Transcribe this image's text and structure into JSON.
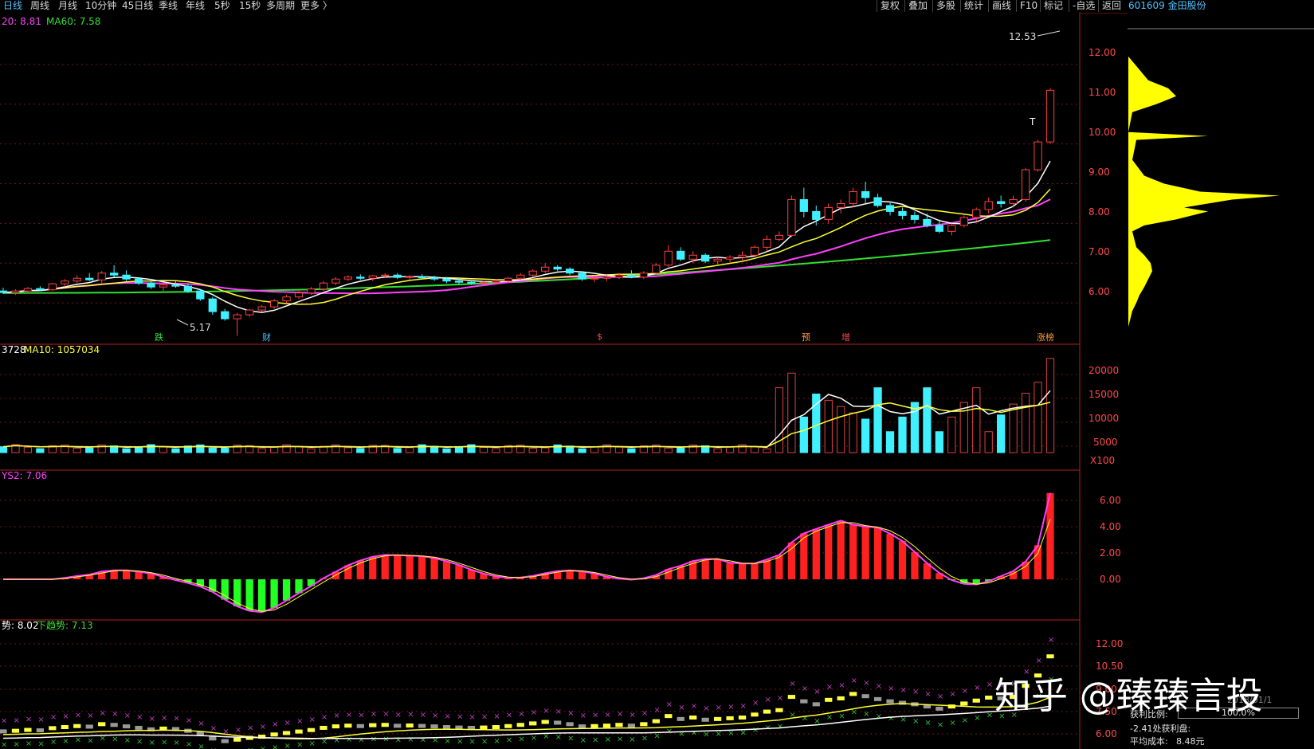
{
  "toolbar": {
    "tabs": [
      "日线",
      "周线",
      "月线",
      "10分钟",
      "45日线",
      "季线",
      "年线",
      "5秒",
      "15秒",
      "多周期",
      "更多 〉"
    ],
    "active_tab": 0,
    "right_buttons": [
      "复权",
      "叠加",
      "多股",
      "统计",
      "画线",
      "F10",
      "标记",
      "-自选",
      "返回"
    ],
    "stock": "601609 金田股份"
  },
  "main_panel": {
    "ma_header": [
      {
        "label": "20: 8.81",
        "color": "#ff40ff"
      },
      {
        "label": "MA60: 7.58",
        "color": "#33e033"
      }
    ],
    "price_ticks": [
      "12.00",
      "11.00",
      "10.00",
      "9.00",
      "8.00",
      "7.00",
      "6.00"
    ],
    "high_label": "12.53",
    "low_label": "5.17",
    "t_marker": "T",
    "events": [
      {
        "text": "跌",
        "color": "#33e033"
      },
      {
        "text": "财",
        "color": "#4fc3ff"
      },
      {
        "text": "$",
        "color": "#ff4a4a"
      },
      {
        "text": "预",
        "color": "#ff9a3c"
      },
      {
        "text": "增",
        "color": "#ff4a4a"
      },
      {
        "text": "涨榜",
        "color": "#ff9a3c"
      }
    ]
  },
  "volume_panel": {
    "header": [
      {
        "label": "3728",
        "color": "#ffffff"
      },
      {
        "label": "MA10: 1057034",
        "color": "#ffff33"
      }
    ],
    "ticks": [
      "20000",
      "15000",
      "10000",
      "5000"
    ],
    "unit": "X100"
  },
  "macd_panel": {
    "header": [
      {
        "label": "YS2: 7.06",
        "color": "#ff40ff"
      }
    ],
    "ticks": [
      "6.00",
      "4.00",
      "2.00",
      "0.00"
    ]
  },
  "trend_panel": {
    "header": [
      {
        "label": "势: 8.02",
        "color": "#ffffff"
      },
      {
        "label": "下趋势: 7.13",
        "color": "#33e033"
      }
    ],
    "ticks": [
      "12.00",
      "10.50",
      "9.00",
      "7.50",
      "6.00"
    ]
  },
  "chip_panel": {
    "date_text": "2018/01/1",
    "profit_label": "获利比例:",
    "profit_value": "100.0%",
    "profit_curve": "-2.41处获利盘:",
    "avg_cost_label": "平均成本:",
    "avg_cost_value": "8.48元"
  },
  "watermark": "知乎 @臻臻言投",
  "chart_data": {
    "type": "candlestick",
    "price_range": [
      5.0,
      12.9
    ],
    "candles": [
      [
        6.3,
        6.38,
        6.22,
        6.26
      ],
      [
        6.26,
        6.34,
        6.2,
        6.3
      ],
      [
        6.3,
        6.4,
        6.25,
        6.36
      ],
      [
        6.36,
        6.42,
        6.3,
        6.33
      ],
      [
        6.33,
        6.5,
        6.3,
        6.48
      ],
      [
        6.48,
        6.6,
        6.4,
        6.55
      ],
      [
        6.55,
        6.7,
        6.5,
        6.62
      ],
      [
        6.62,
        6.75,
        6.55,
        6.58
      ],
      [
        6.58,
        6.8,
        6.5,
        6.75
      ],
      [
        6.75,
        6.95,
        6.65,
        6.7
      ],
      [
        6.7,
        6.82,
        6.55,
        6.6
      ],
      [
        6.6,
        6.65,
        6.45,
        6.5
      ],
      [
        6.5,
        6.55,
        6.35,
        6.4
      ],
      [
        6.4,
        6.5,
        6.3,
        6.45
      ],
      [
        6.45,
        6.55,
        6.38,
        6.42
      ],
      [
        6.42,
        6.48,
        6.25,
        6.3
      ],
      [
        6.3,
        6.35,
        6.05,
        6.1
      ],
      [
        6.1,
        6.15,
        5.7,
        5.78
      ],
      [
        5.78,
        5.85,
        5.55,
        5.6
      ],
      [
        5.6,
        5.75,
        5.17,
        5.7
      ],
      [
        5.7,
        5.85,
        5.65,
        5.82
      ],
      [
        5.82,
        5.95,
        5.78,
        5.9
      ],
      [
        5.9,
        6.1,
        5.85,
        6.05
      ],
      [
        6.05,
        6.2,
        6.0,
        6.15
      ],
      [
        6.15,
        6.3,
        6.1,
        6.25
      ],
      [
        6.25,
        6.4,
        6.2,
        6.35
      ],
      [
        6.35,
        6.55,
        6.3,
        6.5
      ],
      [
        6.5,
        6.65,
        6.45,
        6.6
      ],
      [
        6.6,
        6.7,
        6.55,
        6.65
      ],
      [
        6.65,
        6.72,
        6.58,
        6.62
      ],
      [
        6.62,
        6.7,
        6.55,
        6.68
      ],
      [
        6.68,
        6.75,
        6.62,
        6.7
      ],
      [
        6.7,
        6.75,
        6.6,
        6.64
      ],
      [
        6.64,
        6.7,
        6.58,
        6.66
      ],
      [
        6.66,
        6.72,
        6.6,
        6.63
      ],
      [
        6.63,
        6.68,
        6.55,
        6.6
      ],
      [
        6.6,
        6.65,
        6.5,
        6.55
      ],
      [
        6.55,
        6.62,
        6.48,
        6.52
      ],
      [
        6.52,
        6.58,
        6.45,
        6.5
      ],
      [
        6.5,
        6.55,
        6.45,
        6.52
      ],
      [
        6.52,
        6.6,
        6.48,
        6.55
      ],
      [
        6.55,
        6.65,
        6.5,
        6.62
      ],
      [
        6.62,
        6.75,
        6.58,
        6.7
      ],
      [
        6.7,
        6.85,
        6.65,
        6.8
      ],
      [
        6.8,
        7.0,
        6.75,
        6.9
      ],
      [
        6.9,
        6.95,
        6.8,
        6.85
      ],
      [
        6.85,
        6.9,
        6.7,
        6.75
      ],
      [
        6.75,
        6.8,
        6.55,
        6.6
      ],
      [
        6.6,
        6.68,
        6.52,
        6.62
      ],
      [
        6.62,
        6.7,
        6.55,
        6.65
      ],
      [
        6.65,
        6.75,
        6.6,
        6.7
      ],
      [
        6.7,
        6.82,
        6.62,
        6.65
      ],
      [
        6.65,
        6.8,
        6.6,
        6.75
      ],
      [
        6.75,
        7.0,
        6.7,
        6.95
      ],
      [
        6.95,
        7.45,
        6.9,
        7.3
      ],
      [
        7.3,
        7.4,
        7.05,
        7.1
      ],
      [
        7.1,
        7.3,
        7.0,
        7.2
      ],
      [
        7.2,
        7.25,
        7.0,
        7.05
      ],
      [
        7.05,
        7.15,
        6.95,
        7.1
      ],
      [
        7.1,
        7.2,
        7.0,
        7.15
      ],
      [
        7.15,
        7.3,
        7.05,
        7.2
      ],
      [
        7.2,
        7.45,
        7.15,
        7.4
      ],
      [
        7.4,
        7.7,
        7.3,
        7.6
      ],
      [
        7.6,
        7.8,
        7.55,
        7.7
      ],
      [
        7.7,
        8.7,
        7.65,
        8.6
      ],
      [
        8.6,
        8.9,
        8.15,
        8.3
      ],
      [
        8.3,
        8.45,
        7.95,
        8.1
      ],
      [
        8.1,
        8.5,
        8.0,
        8.4
      ],
      [
        8.4,
        8.6,
        8.25,
        8.5
      ],
      [
        8.5,
        8.9,
        8.4,
        8.8
      ],
      [
        8.8,
        9.05,
        8.5,
        8.65
      ],
      [
        8.65,
        8.75,
        8.4,
        8.45
      ],
      [
        8.45,
        8.55,
        8.2,
        8.3
      ],
      [
        8.3,
        8.4,
        8.1,
        8.2
      ],
      [
        8.2,
        8.3,
        8.0,
        8.1
      ],
      [
        8.1,
        8.25,
        7.9,
        7.95
      ],
      [
        7.95,
        8.1,
        7.75,
        7.8
      ],
      [
        7.8,
        8.0,
        7.7,
        7.95
      ],
      [
        7.95,
        8.2,
        7.9,
        8.15
      ],
      [
        8.15,
        8.4,
        8.05,
        8.35
      ],
      [
        8.35,
        8.65,
        8.25,
        8.55
      ],
      [
        8.55,
        8.7,
        8.4,
        8.5
      ],
      [
        8.5,
        8.7,
        8.4,
        8.6
      ],
      [
        8.6,
        9.4,
        8.55,
        9.35
      ],
      [
        9.35,
        10.1,
        9.3,
        10.05
      ],
      [
        10.05,
        11.4,
        10.0,
        11.35
      ]
    ],
    "ma5_start": 6.3,
    "ma10_start": 6.28,
    "ma20_last": 8.81,
    "ma60_last": 7.58,
    "volume_ma10_last": 1057034,
    "macd_ys2_last": 7.06,
    "trend_upper_last": 8.02,
    "trend_lower_last": 7.13
  }
}
